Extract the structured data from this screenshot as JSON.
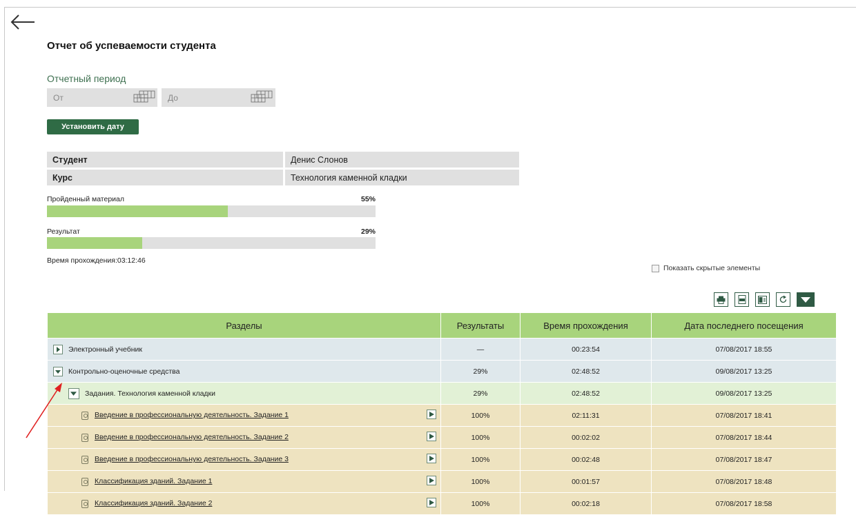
{
  "report": {
    "title": "Отчет об успеваемости студента",
    "period_label": "Отчетный период",
    "from_placeholder": "От",
    "to_placeholder": "До",
    "set_date_label": "Установить дату"
  },
  "info": {
    "student_key": "Студент",
    "student_value": "Денис Слонов",
    "course_key": "Курс",
    "course_value": "Технология каменной кладки"
  },
  "progress": {
    "material_label": "Пройденный материал",
    "material_pct": "55%",
    "material_value": 0.55,
    "result_label": "Результат",
    "result_pct": "29%",
    "result_value": 0.29,
    "time_label": "Время прохождения:03:12:46"
  },
  "options": {
    "show_hidden_label": "Показать скрытые элементы"
  },
  "toolbar": {
    "icons": [
      "print-icon",
      "pdf-icon",
      "excel-icon",
      "refresh-icon",
      "dropdown-icon"
    ]
  },
  "table": {
    "headers": [
      "Разделы",
      "Результаты",
      "Время прохождения",
      "Дата последнего посещения"
    ],
    "rows": [
      {
        "name": "Электронный учебник",
        "result": "—",
        "time": "00:23:54",
        "date": "07/08/2017 18:55"
      },
      {
        "name": "Контрольно-оценочные средства",
        "result": "29%",
        "time": "02:48:52",
        "date": "09/08/2017 13:25"
      },
      {
        "name": "Задания. Технология каменной кладки",
        "result": "29%",
        "time": "02:48:52",
        "date": "09/08/2017 13:25"
      },
      {
        "name": "Введение в профессиональную деятельность. Задание 1",
        "result": "100%",
        "time": "02:11:31",
        "date": "07/08/2017 18:41"
      },
      {
        "name": "Введение в профессиональную деятельность. Задание 2",
        "result": "100%",
        "time": "00:02:02",
        "date": "07/08/2017 18:44"
      },
      {
        "name": "Введение в профессиональную деятельность. Задание 3",
        "result": "100%",
        "time": "00:02:48",
        "date": "07/08/2017 18:47"
      },
      {
        "name": "Классификация зданий. Задание 1",
        "result": "100%",
        "time": "00:01:57",
        "date": "07/08/2017 18:48"
      },
      {
        "name": "Классификация зданий. Задание 2",
        "result": "100%",
        "time": "00:02:18",
        "date": "07/08/2017 18:58"
      }
    ]
  },
  "colors": {
    "accent_green": "#2f6b45",
    "bar_green": "#a8d47c",
    "annotation_red": "#e02020"
  }
}
